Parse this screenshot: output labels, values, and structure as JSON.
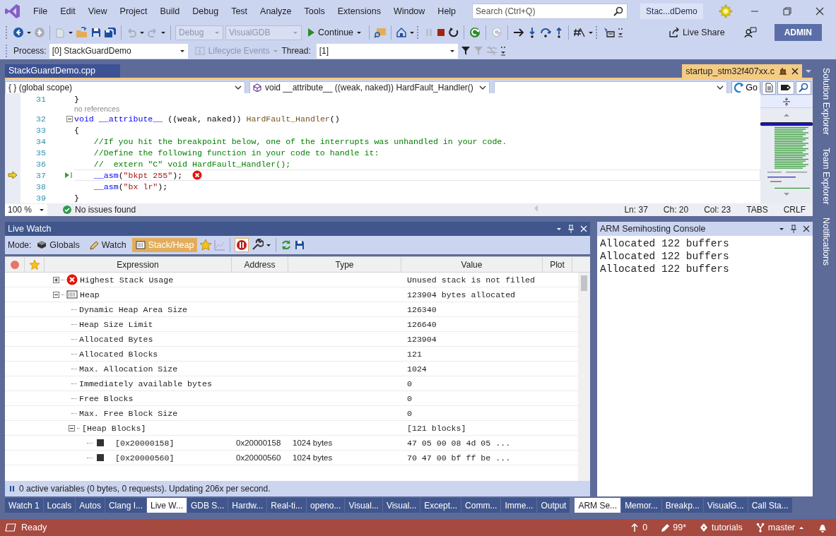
{
  "menu": [
    "File",
    "Edit",
    "View",
    "Project",
    "Build",
    "Debug",
    "Test",
    "Analyze",
    "Tools",
    "Extensions",
    "Window",
    "Help"
  ],
  "search": {
    "placeholder": "Search (Ctrl+Q)"
  },
  "solution_name": "Stac...dDemo",
  "toolbar": {
    "configuration": {
      "label": "Debug",
      "disabled": true
    },
    "platform": {
      "label": "VisualGDB",
      "disabled": true
    },
    "continue": "Continue",
    "live_share": "Live Share",
    "account": "ADMIN"
  },
  "debug_location": {
    "process_label": "Process:",
    "process": "[0] StackGuardDemo",
    "lifecycle": {
      "label": "Lifecycle Events",
      "disabled": true
    },
    "thread_label": "Thread:",
    "thread": "[1]"
  },
  "document_tabs": [
    {
      "label": "StackGuardDemo.cpp",
      "kind": "open"
    },
    {
      "label": "startup_stm32f407xx.c",
      "kind": "preview"
    }
  ],
  "navigation_bar": {
    "scope": "{ } (global scope)",
    "member": "void __attribute__ ((weak, naked)) HardFault_Handler()",
    "go": "Go"
  },
  "code_lines": [
    {
      "kind": "code",
      "number": "31",
      "tokens": [
        {
          "kind": "plain",
          "text": "}"
        }
      ]
    },
    {
      "kind": "codelens",
      "text": "no references"
    },
    {
      "kind": "code",
      "number": "32",
      "fold_expanded": true,
      "tokens": [
        {
          "kind": "keyword",
          "text": "void"
        },
        {
          "kind": "keyword",
          "text": " __attribute__"
        },
        {
          "kind": "plain",
          "text": " ((weak, naked)) "
        },
        {
          "kind": "function",
          "text": "HardFault_Handler"
        },
        {
          "kind": "plain",
          "text": "()"
        }
      ]
    },
    {
      "kind": "code",
      "number": "33",
      "tokens": [
        {
          "kind": "plain",
          "text": "{"
        }
      ]
    },
    {
      "kind": "code",
      "number": "34",
      "tokens": [
        {
          "kind": "comment",
          "text": "    //If you hit the breakpoint below, one of the interrupts was unhandled in your code."
        }
      ]
    },
    {
      "kind": "code",
      "number": "35",
      "tokens": [
        {
          "kind": "comment",
          "text": "    //Define the following function in your code to handle it:"
        }
      ]
    },
    {
      "kind": "code",
      "number": "36",
      "tokens": [
        {
          "kind": "comment",
          "text": "    //  extern \"C\" void HardFault_Handler();"
        }
      ]
    },
    {
      "kind": "code",
      "number": "37",
      "current": true,
      "error": true,
      "tokens": [
        {
          "kind": "keyword",
          "text": "    __asm"
        },
        {
          "kind": "plain",
          "text": "("
        },
        {
          "kind": "string",
          "text": "\"bkpt 255\""
        },
        {
          "kind": "plain",
          "text": ");"
        }
      ]
    },
    {
      "kind": "code",
      "number": "38",
      "tokens": [
        {
          "kind": "keyword",
          "text": "    __asm"
        },
        {
          "kind": "plain",
          "text": "("
        },
        {
          "kind": "string",
          "text": "\"bx lr\""
        },
        {
          "kind": "plain",
          "text": ");"
        }
      ]
    },
    {
      "kind": "code",
      "number": "39",
      "tokens": [
        {
          "kind": "plain",
          "text": "}"
        }
      ]
    }
  ],
  "editor_status": {
    "zoom": "100 %",
    "issues": "No issues found",
    "line": "Ln: 37",
    "char": "Ch: 20",
    "column": "Col: 23",
    "indent": "TABS",
    "line_endings": "CRLF"
  },
  "live_watch": {
    "title": "Live Watch",
    "mode_label": "Mode:",
    "modes": [
      {
        "label": "Globals",
        "kind": "globals",
        "selected": false
      },
      {
        "label": "Watch",
        "kind": "watch",
        "selected": false
      },
      {
        "label": "Stack/Heap",
        "kind": "stackheap",
        "selected": true
      }
    ],
    "columns": [
      "Expression",
      "Address",
      "Type",
      "Value",
      "Plot"
    ],
    "rows": [
      {
        "expression": "Highest Stack Usage",
        "kind": "error",
        "expanded": false,
        "value": "Unused stack is not filled"
      },
      {
        "expression": "Heap",
        "kind": "heap",
        "expanded": true,
        "value": "123904 bytes allocated",
        "children": [
          {
            "expression": "Dynamic Heap Area Size",
            "value": "126340"
          },
          {
            "expression": "Heap Size Limit",
            "value": "126640"
          },
          {
            "expression": "Allocated Bytes",
            "value": "123904"
          },
          {
            "expression": "Allocated Blocks",
            "value": "121"
          },
          {
            "expression": "Max. Allocation Size",
            "value": "1024"
          },
          {
            "expression": "Immediately available bytes",
            "value": "0"
          },
          {
            "expression": "Free Blocks",
            "value": "0"
          },
          {
            "expression": "Max. Free Block Size",
            "value": "0"
          },
          {
            "expression": "[Heap Blocks]",
            "expanded": true,
            "value": "[121 blocks]",
            "children": [
              {
                "expression": "[0x20000158]",
                "kind": "block",
                "address": "0x20000158",
                "type": "1024 bytes",
                "value": "47 05 00 08 4d 05 ..."
              },
              {
                "expression": "[0x20000560]",
                "kind": "block",
                "address": "0x20000560",
                "type": "1024 bytes",
                "value": "70 47 00 bf ff be ..."
              }
            ]
          }
        ]
      }
    ],
    "status": "0 active variables (0 bytes, 0 requests). Updating 206x per second."
  },
  "console": {
    "title": "ARM Semihosting Console",
    "lines": [
      "Allocated 122 buffers",
      "Allocated 122 buffers",
      "Allocated 122 buffers"
    ]
  },
  "side_tabs": [
    "Solution Explorer",
    "Team Explorer",
    "Notifications"
  ],
  "bottom_tabs_left": [
    {
      "label": "Watch 1",
      "selected": false
    },
    {
      "label": "Locals",
      "selected": false
    },
    {
      "label": "Autos",
      "selected": false
    },
    {
      "label": "Clang I...",
      "selected": false
    },
    {
      "label": "Live W...",
      "selected": true
    },
    {
      "label": "GDB S...",
      "selected": false
    },
    {
      "label": "Hardw...",
      "selected": false
    },
    {
      "label": "Real-ti...",
      "selected": false
    },
    {
      "label": "openo...",
      "selected": false
    },
    {
      "label": "Visual...",
      "selected": false
    },
    {
      "label": "Visual...",
      "selected": false
    },
    {
      "label": "Except...",
      "selected": false
    },
    {
      "label": "Comm...",
      "selected": false
    },
    {
      "label": "Imme...",
      "selected": false
    },
    {
      "label": "Output",
      "selected": false
    }
  ],
  "bottom_tabs_right": [
    {
      "label": "ARM Se...",
      "selected": true
    },
    {
      "label": "Memor...",
      "selected": false
    },
    {
      "label": "Breakp...",
      "selected": false
    },
    {
      "label": "VisualG...",
      "selected": false
    },
    {
      "label": "Call Sta...",
      "selected": false
    }
  ],
  "status_bar": {
    "state": "Ready",
    "pushes": "0",
    "changes": "99*",
    "repository": "tutorials",
    "branch": "master"
  }
}
